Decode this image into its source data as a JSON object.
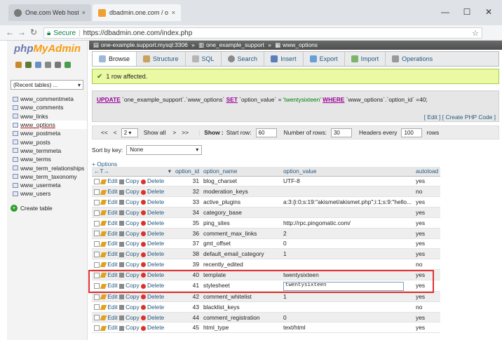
{
  "browser": {
    "tabs": [
      {
        "title": "One.com Web hosting -",
        "close": "×"
      },
      {
        "title": "dbadmin.one.com / one",
        "close": "×"
      }
    ],
    "window_controls": [
      "—",
      "☐",
      "✕"
    ],
    "nav": {
      "back": "←",
      "forward": "→",
      "reload": "↻"
    },
    "secure_label": "Secure",
    "url": "https://dbadmin.one.com/index.php",
    "star": "☆",
    "menu": "⋮"
  },
  "sidebar": {
    "logo_php": "php",
    "logo_myadmin": "MyAdmin",
    "recent_tables": "(Recent tables) ...",
    "tables": [
      "www_commentmeta",
      "www_comments",
      "www_links",
      "www_options",
      "www_postmeta",
      "www_posts",
      "www_termmeta",
      "www_terms",
      "www_term_relationships",
      "www_term_taxonomy",
      "www_usermeta",
      "www_users"
    ],
    "create_table": "Create table"
  },
  "breadcrumb": {
    "server": "one-example.support.mysql:3306",
    "db": "one_example_support",
    "table": "www_options",
    "sep": "»"
  },
  "tabs": [
    "Browse",
    "Structure",
    "SQL",
    "Search",
    "Insert",
    "Export",
    "Import",
    "Operations"
  ],
  "message": "1 row affected.",
  "sql": {
    "kw_update": "UPDATE",
    "table_part": " `one_example_support`.`www_options` ",
    "kw_set": "SET",
    "set_part": " `option_value` = ",
    "value": "'twentysixteen'",
    "kw_where": "WHERE",
    "where_part": " `www_options`.`option_id` =40;",
    "links": "[ Edit ] [ Create PHP Code ]"
  },
  "pagination": {
    "first": "<<",
    "prev": "<",
    "page": "2",
    "show_all": "Show all",
    "next": ">",
    "last": ">>",
    "show_label": "Show :",
    "start_row_label": "Start row:",
    "start_row": "60",
    "num_rows_label": "Number of rows:",
    "num_rows": "30",
    "headers_label": "Headers every",
    "headers": "100",
    "rows_label": "rows"
  },
  "sort": {
    "label": "Sort by key:",
    "value": "None"
  },
  "options_link": "+ Options",
  "table": {
    "arrows": "←T→",
    "headers": [
      "option_id",
      "option_name",
      "option_value",
      "autoload"
    ],
    "actions": {
      "edit": "Edit",
      "copy": "Copy",
      "delete": "Delete"
    },
    "rows": [
      {
        "id": "31",
        "name": "blog_charset",
        "value": "UTF-8",
        "auto": "yes"
      },
      {
        "id": "32",
        "name": "moderation_keys",
        "value": "",
        "auto": "no"
      },
      {
        "id": "33",
        "name": "active_plugins",
        "value": "a:3:{i:0;s:19:\"akismet/akismet.php\";i:1;s:9:\"hello...",
        "auto": "yes"
      },
      {
        "id": "34",
        "name": "category_base",
        "value": "",
        "auto": "yes"
      },
      {
        "id": "35",
        "name": "ping_sites",
        "value": "http://rpc.pingomatic.com/",
        "auto": "yes"
      },
      {
        "id": "36",
        "name": "comment_max_links",
        "value": "2",
        "auto": "yes"
      },
      {
        "id": "37",
        "name": "gmt_offset",
        "value": "0",
        "auto": "yes"
      },
      {
        "id": "38",
        "name": "default_email_category",
        "value": "1",
        "auto": "yes"
      },
      {
        "id": "39",
        "name": "recently_edited",
        "value": "",
        "auto": "no"
      },
      {
        "id": "40",
        "name": "template",
        "value": "twentysixteen",
        "auto": "yes"
      },
      {
        "id": "41",
        "name": "stylesheet",
        "value": "twentysixteen",
        "auto": "yes",
        "editing": true
      },
      {
        "id": "42",
        "name": "comment_whitelist",
        "value": "1",
        "auto": "yes"
      },
      {
        "id": "43",
        "name": "blacklist_keys",
        "value": "",
        "auto": "no"
      },
      {
        "id": "44",
        "name": "comment_registration",
        "value": "0",
        "auto": "yes"
      },
      {
        "id": "45",
        "name": "html_type",
        "value": "text/html",
        "auto": "yes"
      }
    ]
  }
}
